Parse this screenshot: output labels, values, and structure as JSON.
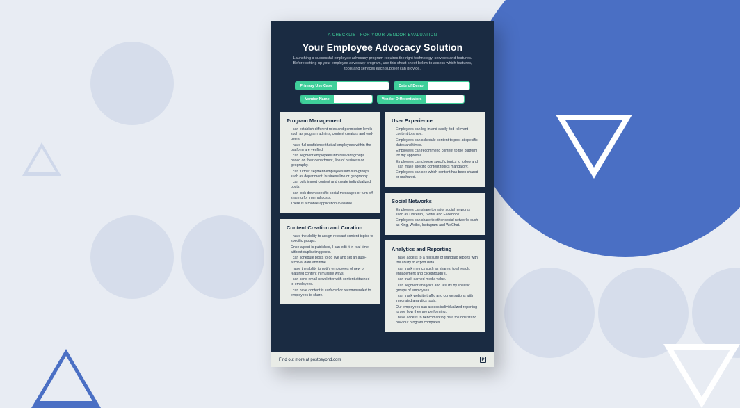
{
  "eyebrow": "A CHECKLIST FOR YOUR VENDOR EVALUATION",
  "title": "Your Employee Advocacy Solution",
  "intro": "Launching a successful employee advocacy program requires the right technology, services and features. Before setting up your employee advocacy program, use this cheat sheet below to assess which features, tools and services each supplier can provide.",
  "fields": {
    "primary_use_case": "Primary Use Case",
    "date_of_demo": "Date of Demo",
    "vendor_name": "Vendor Name",
    "vendor_differentiators": "Vendor Differentiators"
  },
  "cards": {
    "program_management": {
      "heading": "Program Management",
      "items": [
        "I can establish different roles and permission levels such as program admins, content creators and end-users.",
        "I have full confidence that all employees within the platform are verified.",
        "I can segment employees into relevant groups based on their department, line of business or geography.",
        "I can further segment employees into sub-groups such as department, business line or geography.",
        "I can bulk import content and create individualized posts.",
        "I can lock down specific social messages or turn off sharing for internal posts.",
        "There is a mobile application available."
      ]
    },
    "content_creation": {
      "heading": "Content Creation and Curation",
      "items": [
        "I have the ability to assign relevant content topics to specific groups.",
        "Once a post is published, I can edit it in real-time without duplicating posts.",
        "I can schedule posts to go live and set an auto-archival date and time.",
        "I have the ability to notify employees of new or featured content in multiple ways.",
        "I can send email newsletter with content attached to employees.",
        "I can have content is surfaced or recommended to employees to share."
      ]
    },
    "user_experience": {
      "heading": "User Experience",
      "items": [
        "Employees can log-in and easily find relevant content to share.",
        "Employees can schedule content to post at specific dates and times.",
        "Employees can recommend content to the platform for my approval.",
        "Employees can choose specific topics to follow and I can make specific content topics mandatory.",
        "Employees can see which content has been shared or unshared."
      ]
    },
    "social_networks": {
      "heading": "Social Networks",
      "items": [
        "Employees can share to major social networks such as LinkedIn, Twitter and Facebook.",
        "Employees can share to other social networks such as Xing, Weibo, Instagram and WeChat."
      ]
    },
    "analytics": {
      "heading": "Analytics and Reporting",
      "items": [
        "I have access to a full suite of standard reports with the ability to export data.",
        "I can track metrics such as shares, total reach, engagement and clickthrough's.",
        "I can track earned media value.",
        "I can segment analytics and results by specific groups of employees.",
        "I can track website traffic and conversations with integrated analytics tools.",
        "Our employees can access individualized reporting to see how they are performing.",
        "I have access to benchmarking data to understand how our program compares."
      ]
    }
  },
  "footer": "Find out more at postbeyond.com",
  "logo_letter": "P"
}
